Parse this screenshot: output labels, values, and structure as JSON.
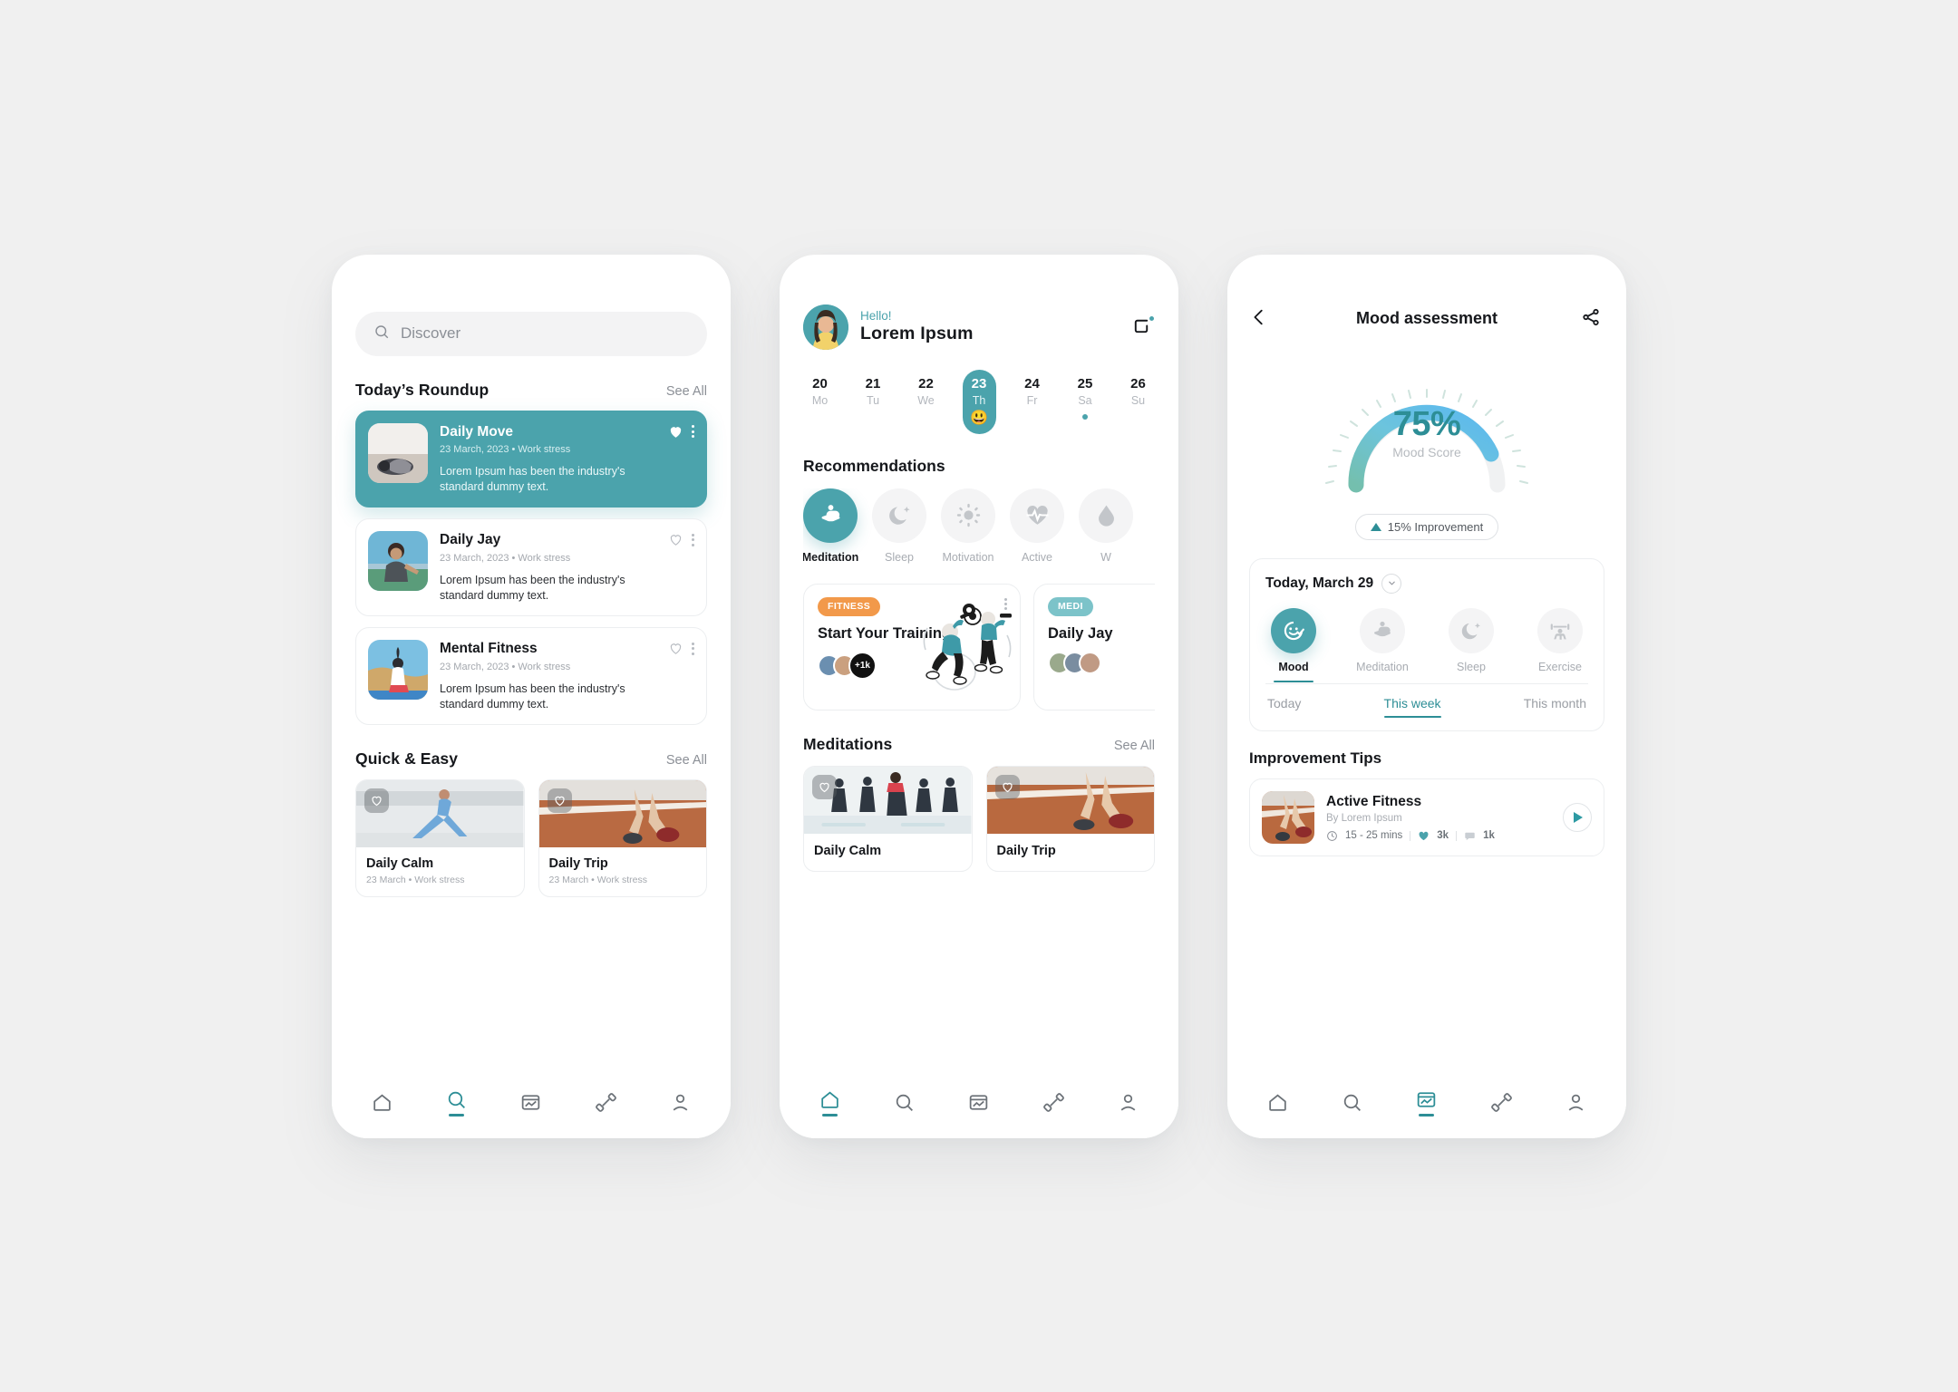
{
  "theme": {
    "teal": "#4ba3ac",
    "teal_dark": "#2d8e96",
    "orange": "#f2994a",
    "gray_text": "#8b8f96"
  },
  "phone1": {
    "search": {
      "placeholder": "Discover",
      "icon": "search-icon"
    },
    "roundup": {
      "title": "Today’s Roundup",
      "see_all": "See All"
    },
    "roundup_items": [
      {
        "title": "Daily Move",
        "meta": "23 March, 2023 • Work stress",
        "desc": "Lorem Ipsum has been the industry's standard dummy text.",
        "selected": true,
        "liked": true
      },
      {
        "title": "Daily Jay",
        "meta": "23 March, 2023 • Work stress",
        "desc": "Lorem Ipsum has been the industry's standard dummy text.",
        "selected": false,
        "liked": false
      },
      {
        "title": "Mental Fitness",
        "meta": "23 March, 2023 • Work stress",
        "desc": "Lorem Ipsum has been the industry's standard dummy text.",
        "selected": false,
        "liked": false
      }
    ],
    "quick": {
      "title": "Quick & Easy",
      "see_all": "See All"
    },
    "quick_items": [
      {
        "title": "Daily Calm",
        "meta": "23 March • Work stress"
      },
      {
        "title": "Daily Trip",
        "meta": "23 March • Work stress"
      }
    ],
    "nav": [
      {
        "icon": "home-icon",
        "active": false
      },
      {
        "icon": "search-icon",
        "active": true
      },
      {
        "icon": "report-icon",
        "active": false
      },
      {
        "icon": "dumbbell-icon",
        "active": false
      },
      {
        "icon": "profile-icon",
        "active": false
      }
    ]
  },
  "phone2": {
    "greeting": "Hello!",
    "user_name": "Lorem Ipsum",
    "notification_icon": "notification-icon",
    "days": [
      {
        "num": "20",
        "dow": "Mo",
        "selected": false,
        "dot": false,
        "emoji": ""
      },
      {
        "num": "21",
        "dow": "Tu",
        "selected": false,
        "dot": false,
        "emoji": ""
      },
      {
        "num": "22",
        "dow": "We",
        "selected": false,
        "dot": false,
        "emoji": ""
      },
      {
        "num": "23",
        "dow": "Th",
        "selected": true,
        "dot": false,
        "emoji": "😃"
      },
      {
        "num": "24",
        "dow": "Fr",
        "selected": false,
        "dot": false,
        "emoji": ""
      },
      {
        "num": "25",
        "dow": "Sa",
        "selected": false,
        "dot": true,
        "emoji": ""
      },
      {
        "num": "26",
        "dow": "Su",
        "selected": false,
        "dot": false,
        "emoji": ""
      }
    ],
    "recommendations_title": "Recommendations",
    "recommendations": [
      {
        "label": "Meditation",
        "icon": "meditation-icon",
        "active": true
      },
      {
        "label": "Sleep",
        "icon": "moon-icon",
        "active": false
      },
      {
        "label": "Motivation",
        "icon": "sun-icon",
        "active": false
      },
      {
        "label": "Active",
        "icon": "heartbeat-icon",
        "active": false
      },
      {
        "label": "W",
        "icon": "water-icon",
        "active": false
      }
    ],
    "promos": [
      {
        "badge": "FITNESS",
        "badge_color": "#f2994a",
        "title": "Start Your Training",
        "count": "+1k"
      },
      {
        "badge": "MEDI",
        "badge_color": "#7cc3c9",
        "title": "Daily Jay",
        "count": ""
      }
    ],
    "meditations": {
      "title": "Meditations",
      "see_all": "See All"
    },
    "meditation_items": [
      {
        "title": "Daily Calm"
      },
      {
        "title": "Daily Trip"
      }
    ],
    "nav": [
      {
        "icon": "home-icon",
        "active": true
      },
      {
        "icon": "search-icon",
        "active": false
      },
      {
        "icon": "report-icon",
        "active": false
      },
      {
        "icon": "dumbbell-icon",
        "active": false
      },
      {
        "icon": "profile-icon",
        "active": false
      }
    ]
  },
  "phone3": {
    "back_icon": "back-arrow-icon",
    "title": "Mood assessment",
    "share_icon": "share-icon",
    "gauge": {
      "percent": "75%",
      "label": "Mood Score",
      "value": 75
    },
    "improvement": "15% Improvement",
    "date_label": "Today, March 29",
    "chevron_icon": "chevron-down-icon",
    "modes": [
      {
        "label": "Mood",
        "icon": "smiley-check-icon",
        "active": true
      },
      {
        "label": "Meditation",
        "icon": "meditation-icon",
        "active": false
      },
      {
        "label": "Sleep",
        "icon": "moon-icon",
        "active": false
      },
      {
        "label": "Exercise",
        "icon": "weightlifter-icon",
        "active": false
      }
    ],
    "subtabs": [
      {
        "label": "Today",
        "active": false
      },
      {
        "label": "This week",
        "active": true
      },
      {
        "label": "This month",
        "active": false
      }
    ],
    "tips_title": "Improvement Tips",
    "tip": {
      "title": "Active Fitness",
      "by": "By Lorem Ipsum",
      "duration": "15 - 25 mins",
      "likes": "3k",
      "comments": "1k"
    },
    "nav": [
      {
        "icon": "home-icon",
        "active": false
      },
      {
        "icon": "search-icon",
        "active": false
      },
      {
        "icon": "report-icon",
        "active": true
      },
      {
        "icon": "dumbbell-icon",
        "active": false
      },
      {
        "icon": "profile-icon",
        "active": false
      }
    ]
  },
  "chart_data": {
    "type": "gauge",
    "title": "Mood Score",
    "value": 75,
    "unit": "%",
    "range": [
      0,
      100
    ],
    "annotation": "15% Improvement",
    "gradient": [
      "#74bfae",
      "#6cc4dd",
      "#5bb8ef"
    ]
  }
}
